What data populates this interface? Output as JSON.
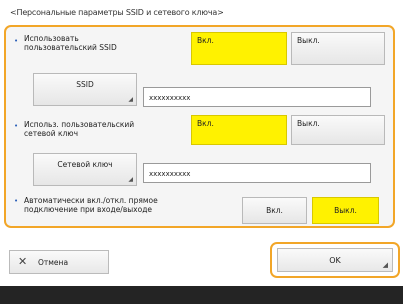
{
  "title": "<Персональные параметры SSID и сетевого ключа>",
  "ssid_section": {
    "label": "Использовать\nпользовательский SSID",
    "on_label": "Вкл.",
    "off_label": "Выкл.",
    "selected": "on",
    "key_button_label": "SSID",
    "value": "xxxxxxxxxx"
  },
  "key_section": {
    "label": "Использ. пользовательский\nсетевой ключ",
    "on_label": "Вкл.",
    "off_label": "Выкл.",
    "selected": "on",
    "key_button_label": "Сетевой ключ",
    "value": "xxxxxxxxxx"
  },
  "auto_section": {
    "label": "Автоматически вкл./откл. прямое\nподключение при входе/выходе",
    "on_label": "Вкл.",
    "off_label": "Выкл.",
    "selected": "off"
  },
  "footer_buttons": {
    "cancel_label": "Отмена",
    "ok_label": "OK"
  },
  "colors": {
    "highlight_border": "#f2a628",
    "selected_button": "#fff200",
    "bullet": "#2a5fb8",
    "footer_bar": "#242424"
  },
  "icons": {
    "bullet": "bullet-icon",
    "cancel": "close-icon",
    "corner": "corner-arrow-icon"
  }
}
